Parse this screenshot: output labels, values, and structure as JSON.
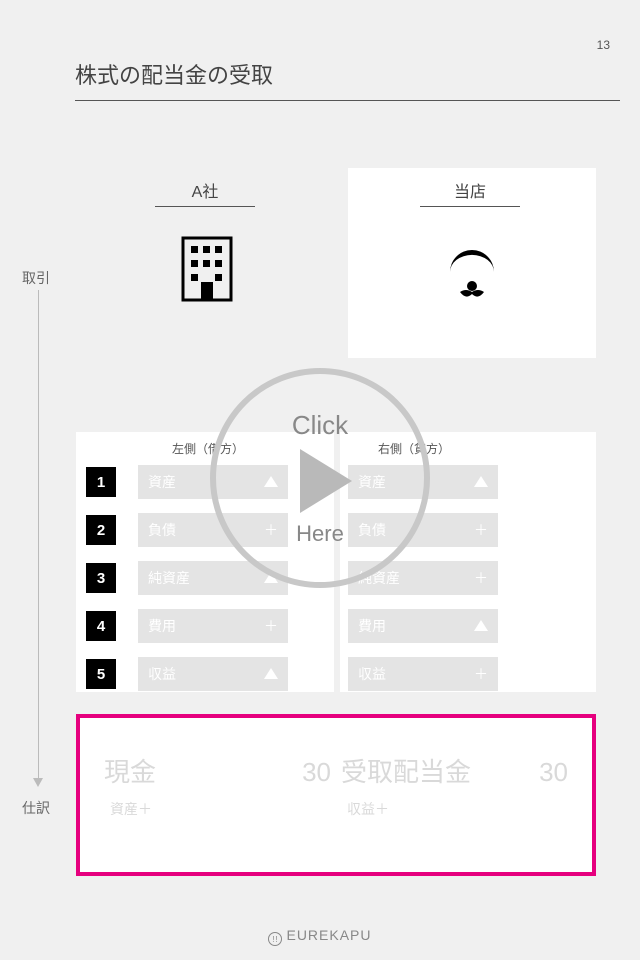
{
  "page_number": "13",
  "title": "株式の配当金の受取",
  "side_labels": {
    "transaction": "取引",
    "journal": "仕訳"
  },
  "entities": {
    "a": "A社",
    "store": "当店"
  },
  "table": {
    "header_left": "左側（借方）",
    "header_right": "右側（貸方）",
    "rows": [
      {
        "num": "1",
        "left": {
          "label": "資産",
          "mark": "tri"
        },
        "right": {
          "label": "資産",
          "mark": "tri"
        }
      },
      {
        "num": "2",
        "left": {
          "label": "負債",
          "mark": "+"
        },
        "right": {
          "label": "負債",
          "mark": "+"
        }
      },
      {
        "num": "3",
        "left": {
          "label": "純資産",
          "mark": "tri"
        },
        "right": {
          "label": "純資産",
          "mark": "+"
        }
      },
      {
        "num": "4",
        "left": {
          "label": "費用",
          "mark": "+"
        },
        "right": {
          "label": "費用",
          "mark": "tri"
        }
      },
      {
        "num": "5",
        "left": {
          "label": "収益",
          "mark": "tri"
        },
        "right": {
          "label": "収益",
          "mark": "+"
        }
      }
    ]
  },
  "journal": {
    "debit": {
      "account": "現金",
      "amount": "30",
      "sub": "資産＋"
    },
    "credit": {
      "account": "受取配当金",
      "amount": "30",
      "sub": "収益＋"
    }
  },
  "overlay": {
    "line1": "Click",
    "line2": "Here"
  },
  "footer_brand": "EUREKAPU"
}
